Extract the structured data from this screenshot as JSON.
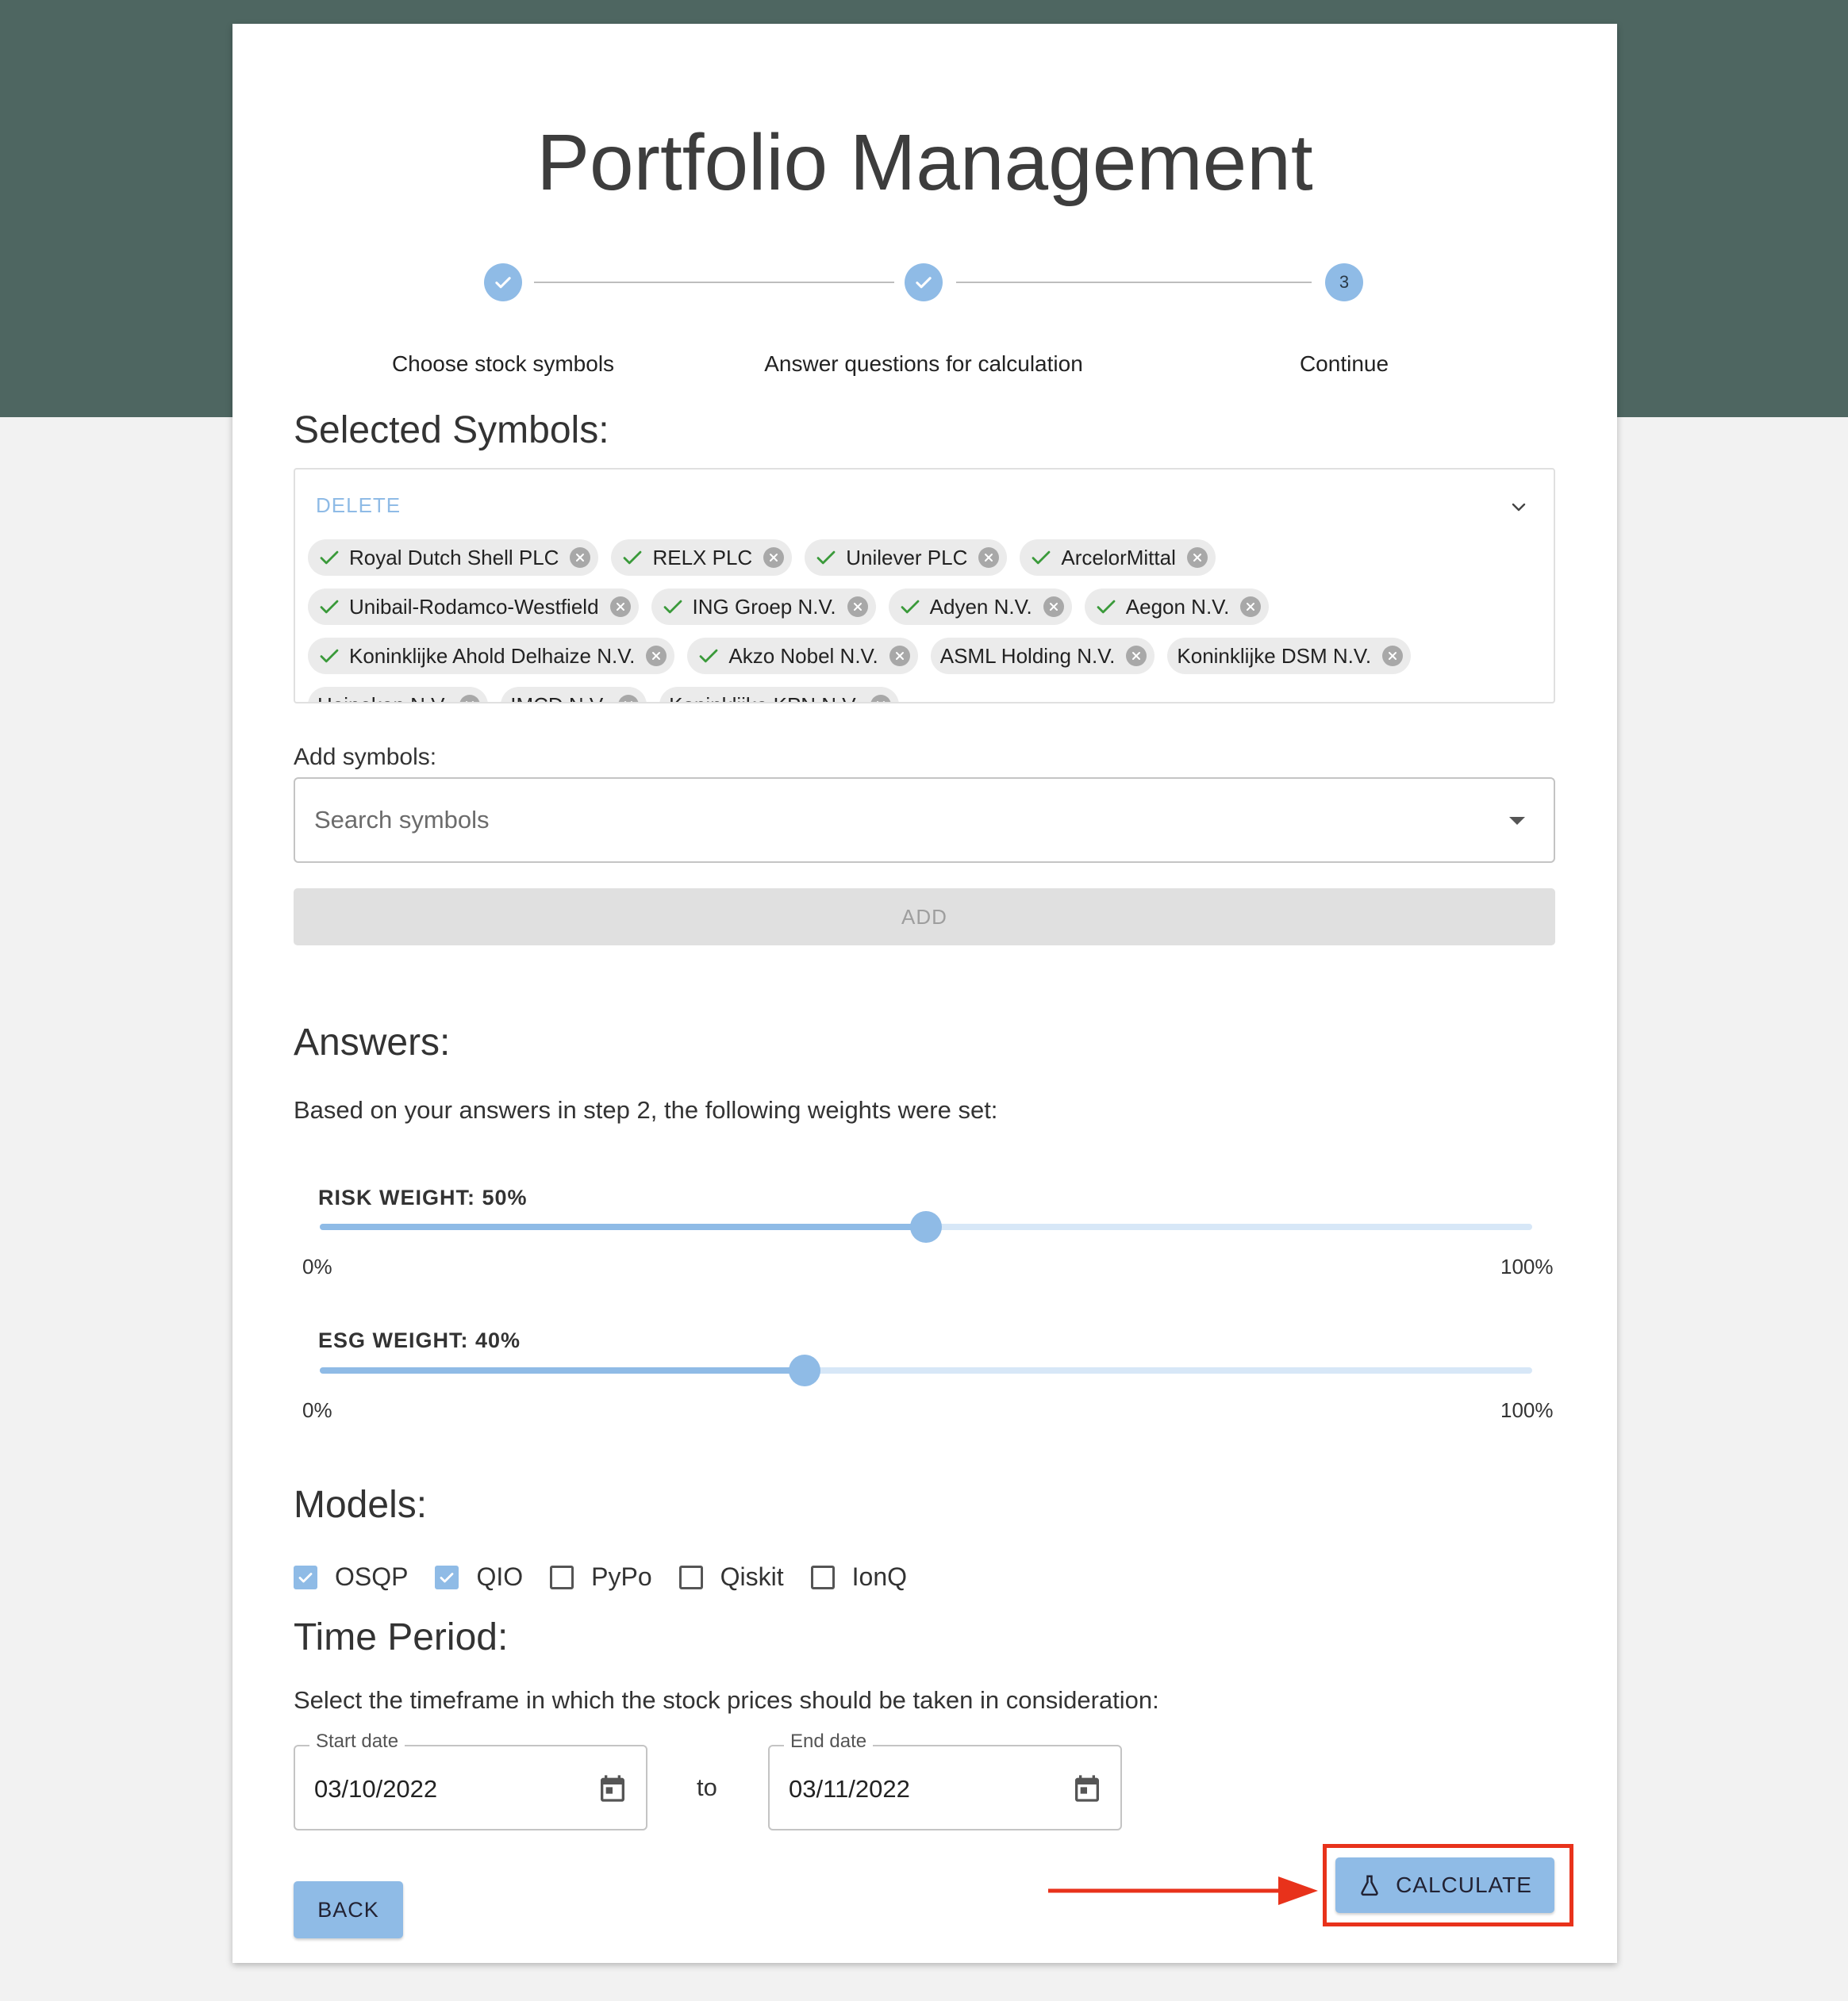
{
  "title": "Portfolio Management",
  "stepper": {
    "steps": [
      {
        "label": "Choose stock symbols",
        "state": "done"
      },
      {
        "label": "Answer questions for calculation",
        "state": "done"
      },
      {
        "label": "Continue",
        "state": "active",
        "number": "3"
      }
    ]
  },
  "selected_symbols": {
    "heading": "Selected Symbols:",
    "delete_label": "DELETE",
    "chips": [
      {
        "label": "Royal Dutch Shell PLC",
        "checked": true
      },
      {
        "label": "RELX PLC",
        "checked": true
      },
      {
        "label": "Unilever PLC",
        "checked": true
      },
      {
        "label": "ArcelorMittal",
        "checked": true
      },
      {
        "label": "Unibail-Rodamco-Westfield",
        "checked": true
      },
      {
        "label": "ING Groep N.V.",
        "checked": true
      },
      {
        "label": "Adyen N.V.",
        "checked": true
      },
      {
        "label": "Aegon N.V.",
        "checked": true
      },
      {
        "label": "Koninklijke Ahold Delhaize N.V.",
        "checked": true
      },
      {
        "label": "Akzo Nobel N.V.",
        "checked": true
      },
      {
        "label": "ASML Holding N.V.",
        "checked": false
      },
      {
        "label": "Koninklijke DSM N.V.",
        "checked": false
      },
      {
        "label": "Heineken N.V.",
        "checked": false
      },
      {
        "label": "IMCD N.V.",
        "checked": false
      },
      {
        "label": "Koninklijke KPN N.V.",
        "checked": false
      }
    ]
  },
  "add_symbols": {
    "label": "Add symbols:",
    "placeholder": "Search symbols",
    "add_button": "ADD"
  },
  "answers": {
    "heading": "Answers:",
    "description": "Based on your answers in step 2, the following weights were set:",
    "sliders": [
      {
        "label": "RISK WEIGHT: 50%",
        "value": 50,
        "min_label": "0%",
        "max_label": "100%"
      },
      {
        "label": "ESG WEIGHT: 40%",
        "value": 40,
        "min_label": "0%",
        "max_label": "100%"
      }
    ]
  },
  "models": {
    "heading": "Models:",
    "options": [
      {
        "label": "OSQP",
        "checked": true
      },
      {
        "label": "QIO",
        "checked": true
      },
      {
        "label": "PyPo",
        "checked": false
      },
      {
        "label": "Qiskit",
        "checked": false
      },
      {
        "label": "IonQ",
        "checked": false
      }
    ]
  },
  "time_period": {
    "heading": "Time Period:",
    "description": "Select the timeframe in which the stock prices should be taken in consideration:",
    "start_label": "Start date",
    "start_value": "03/10/2022",
    "separator": "to",
    "end_label": "End date",
    "end_value": "03/11/2022"
  },
  "actions": {
    "back": "BACK",
    "calculate": "CALCULATE"
  },
  "colors": {
    "header_bg": "#4e6661",
    "accent": "#8fbbe6",
    "highlight": "#e8321b"
  }
}
